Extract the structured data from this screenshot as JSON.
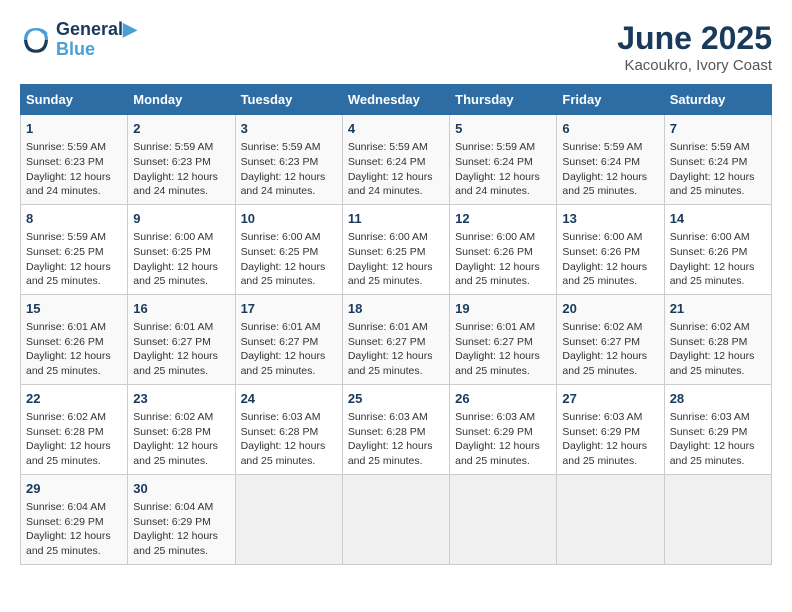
{
  "header": {
    "logo_line1": "General",
    "logo_line2": "Blue",
    "title": "June 2025",
    "subtitle": "Kacoukro, Ivory Coast"
  },
  "days_of_week": [
    "Sunday",
    "Monday",
    "Tuesday",
    "Wednesday",
    "Thursday",
    "Friday",
    "Saturday"
  ],
  "weeks": [
    [
      {
        "day": "1",
        "info": "Sunrise: 5:59 AM\nSunset: 6:23 PM\nDaylight: 12 hours\nand 24 minutes."
      },
      {
        "day": "2",
        "info": "Sunrise: 5:59 AM\nSunset: 6:23 PM\nDaylight: 12 hours\nand 24 minutes."
      },
      {
        "day": "3",
        "info": "Sunrise: 5:59 AM\nSunset: 6:23 PM\nDaylight: 12 hours\nand 24 minutes."
      },
      {
        "day": "4",
        "info": "Sunrise: 5:59 AM\nSunset: 6:24 PM\nDaylight: 12 hours\nand 24 minutes."
      },
      {
        "day": "5",
        "info": "Sunrise: 5:59 AM\nSunset: 6:24 PM\nDaylight: 12 hours\nand 24 minutes."
      },
      {
        "day": "6",
        "info": "Sunrise: 5:59 AM\nSunset: 6:24 PM\nDaylight: 12 hours\nand 25 minutes."
      },
      {
        "day": "7",
        "info": "Sunrise: 5:59 AM\nSunset: 6:24 PM\nDaylight: 12 hours\nand 25 minutes."
      }
    ],
    [
      {
        "day": "8",
        "info": "Sunrise: 5:59 AM\nSunset: 6:25 PM\nDaylight: 12 hours\nand 25 minutes."
      },
      {
        "day": "9",
        "info": "Sunrise: 6:00 AM\nSunset: 6:25 PM\nDaylight: 12 hours\nand 25 minutes."
      },
      {
        "day": "10",
        "info": "Sunrise: 6:00 AM\nSunset: 6:25 PM\nDaylight: 12 hours\nand 25 minutes."
      },
      {
        "day": "11",
        "info": "Sunrise: 6:00 AM\nSunset: 6:25 PM\nDaylight: 12 hours\nand 25 minutes."
      },
      {
        "day": "12",
        "info": "Sunrise: 6:00 AM\nSunset: 6:26 PM\nDaylight: 12 hours\nand 25 minutes."
      },
      {
        "day": "13",
        "info": "Sunrise: 6:00 AM\nSunset: 6:26 PM\nDaylight: 12 hours\nand 25 minutes."
      },
      {
        "day": "14",
        "info": "Sunrise: 6:00 AM\nSunset: 6:26 PM\nDaylight: 12 hours\nand 25 minutes."
      }
    ],
    [
      {
        "day": "15",
        "info": "Sunrise: 6:01 AM\nSunset: 6:26 PM\nDaylight: 12 hours\nand 25 minutes."
      },
      {
        "day": "16",
        "info": "Sunrise: 6:01 AM\nSunset: 6:27 PM\nDaylight: 12 hours\nand 25 minutes."
      },
      {
        "day": "17",
        "info": "Sunrise: 6:01 AM\nSunset: 6:27 PM\nDaylight: 12 hours\nand 25 minutes."
      },
      {
        "day": "18",
        "info": "Sunrise: 6:01 AM\nSunset: 6:27 PM\nDaylight: 12 hours\nand 25 minutes."
      },
      {
        "day": "19",
        "info": "Sunrise: 6:01 AM\nSunset: 6:27 PM\nDaylight: 12 hours\nand 25 minutes."
      },
      {
        "day": "20",
        "info": "Sunrise: 6:02 AM\nSunset: 6:27 PM\nDaylight: 12 hours\nand 25 minutes."
      },
      {
        "day": "21",
        "info": "Sunrise: 6:02 AM\nSunset: 6:28 PM\nDaylight: 12 hours\nand 25 minutes."
      }
    ],
    [
      {
        "day": "22",
        "info": "Sunrise: 6:02 AM\nSunset: 6:28 PM\nDaylight: 12 hours\nand 25 minutes."
      },
      {
        "day": "23",
        "info": "Sunrise: 6:02 AM\nSunset: 6:28 PM\nDaylight: 12 hours\nand 25 minutes."
      },
      {
        "day": "24",
        "info": "Sunrise: 6:03 AM\nSunset: 6:28 PM\nDaylight: 12 hours\nand 25 minutes."
      },
      {
        "day": "25",
        "info": "Sunrise: 6:03 AM\nSunset: 6:28 PM\nDaylight: 12 hours\nand 25 minutes."
      },
      {
        "day": "26",
        "info": "Sunrise: 6:03 AM\nSunset: 6:29 PM\nDaylight: 12 hours\nand 25 minutes."
      },
      {
        "day": "27",
        "info": "Sunrise: 6:03 AM\nSunset: 6:29 PM\nDaylight: 12 hours\nand 25 minutes."
      },
      {
        "day": "28",
        "info": "Sunrise: 6:03 AM\nSunset: 6:29 PM\nDaylight: 12 hours\nand 25 minutes."
      }
    ],
    [
      {
        "day": "29",
        "info": "Sunrise: 6:04 AM\nSunset: 6:29 PM\nDaylight: 12 hours\nand 25 minutes."
      },
      {
        "day": "30",
        "info": "Sunrise: 6:04 AM\nSunset: 6:29 PM\nDaylight: 12 hours\nand 25 minutes."
      },
      {
        "day": "",
        "info": ""
      },
      {
        "day": "",
        "info": ""
      },
      {
        "day": "",
        "info": ""
      },
      {
        "day": "",
        "info": ""
      },
      {
        "day": "",
        "info": ""
      }
    ]
  ]
}
